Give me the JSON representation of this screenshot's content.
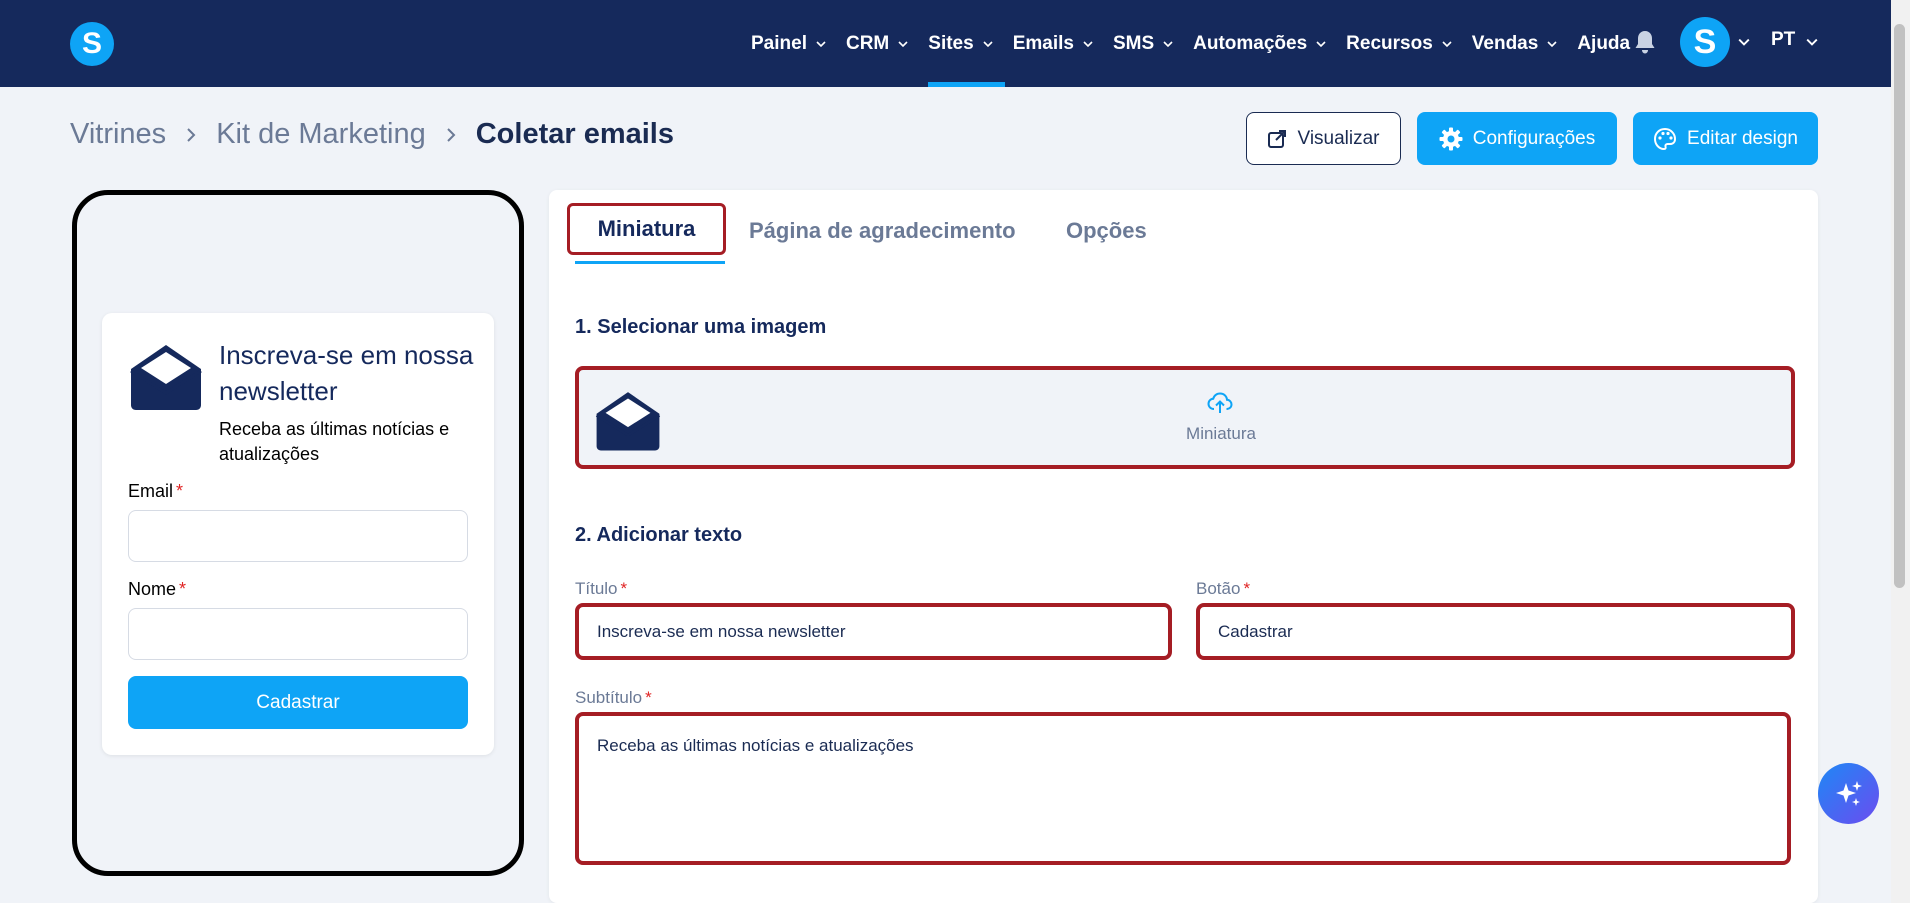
{
  "navbar": {
    "brand_letter": "S",
    "items": [
      {
        "label": "Painel"
      },
      {
        "label": "CRM"
      },
      {
        "label": "Sites"
      },
      {
        "label": "Emails"
      },
      {
        "label": "SMS"
      },
      {
        "label": "Automações"
      },
      {
        "label": "Recursos"
      },
      {
        "label": "Vendas"
      },
      {
        "label": "Ajuda"
      }
    ],
    "active_item": "Sites",
    "avatar_letter": "S",
    "language": "PT"
  },
  "breadcrumb": {
    "items": [
      "Vitrines",
      "Kit de Marketing",
      "Coletar emails"
    ]
  },
  "actions": {
    "preview": "Visualizar",
    "settings": "Configurações",
    "edit_design": "Editar design"
  },
  "preview": {
    "title": "Inscreva-se em nossa newsletter",
    "subtitle": "Receba as últimas notícias e atualizações",
    "email_label": "Email",
    "name_label": "Nome",
    "required_mark": "*",
    "button": "Cadastrar"
  },
  "tabs": [
    {
      "label": "Miniatura",
      "active": true
    },
    {
      "label": "Página de agradecimento",
      "active": false
    },
    {
      "label": "Opções",
      "active": false
    }
  ],
  "editor": {
    "section1_title": "1. Selecionar uma imagem",
    "upload_label": "Miniatura",
    "section2_title": "2. Adicionar texto",
    "title_label": "Título",
    "title_value": "Inscreva-se em nossa newsletter",
    "button_label": "Botão",
    "button_value": "Cadastrar",
    "subtitle_label": "Subtítulo",
    "subtitle_value": "Receba as últimas notícias e atualizações",
    "required_mark": "*"
  },
  "colors": {
    "navbar": "#15295c",
    "accent": "#0ea4f6",
    "highlight_border": "#a51d24",
    "required": "#e02424"
  },
  "icons": {
    "bell": "bell-icon",
    "envelope": "envelope-open-icon",
    "upload": "cloud-upload-icon",
    "external": "external-link-icon",
    "gear": "gear-icon",
    "palette": "palette-icon",
    "sparkles": "sparkles-icon"
  }
}
